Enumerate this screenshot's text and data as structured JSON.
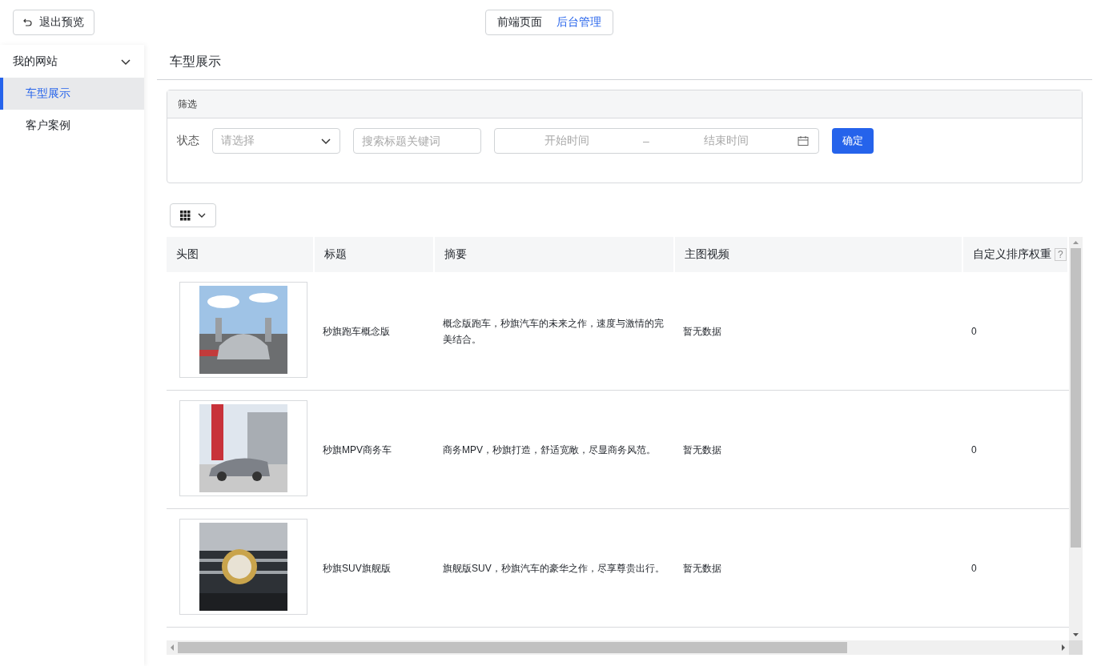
{
  "top_bar": {
    "exit_button": {
      "label": "退出预览"
    },
    "mode_tabs": [
      {
        "label": "前端页面",
        "selected": false
      },
      {
        "label": "后台管理",
        "selected": true
      }
    ]
  },
  "sidebar": {
    "groups": [
      {
        "label": "我的网站",
        "expanded": true,
        "children": [
          {
            "label": "车型展示",
            "selected": true
          },
          {
            "label": "客户案例",
            "selected": false
          }
        ]
      }
    ]
  },
  "page_title": "车型展示",
  "filter": {
    "title": "筛选",
    "status_label": "状态",
    "status_select": {
      "placeholder": "请选择"
    },
    "search": {
      "placeholder": "搜索标题关键词"
    },
    "date_range": {
      "start_placeholder": "开始时间",
      "separator": "–",
      "end_placeholder": "结束时间"
    },
    "confirm_button": "确定"
  },
  "table": {
    "columns": [
      {
        "label": "头图"
      },
      {
        "label": "标题"
      },
      {
        "label": "摘要"
      },
      {
        "label": "主图视频"
      },
      {
        "label": "自定义排序权重",
        "help": "?"
      }
    ],
    "rows": [
      {
        "title": "秒旗跑车概念版",
        "summary": "概念版跑车，秒旗汽车的未来之作，速度与激情的完美结合。",
        "video": "暂无数据",
        "weight": "0"
      },
      {
        "title": "秒旗MPV商务车",
        "summary": "商务MPV，秒旗打造，舒适宽敞，尽显商务风范。",
        "video": "暂无数据",
        "weight": "0"
      },
      {
        "title": "秒旗SUV旗舰版",
        "summary": "旗舰版SUV，秒旗汽车的豪华之作，尽享尊贵出行。",
        "video": "暂无数据",
        "weight": "0"
      }
    ]
  }
}
